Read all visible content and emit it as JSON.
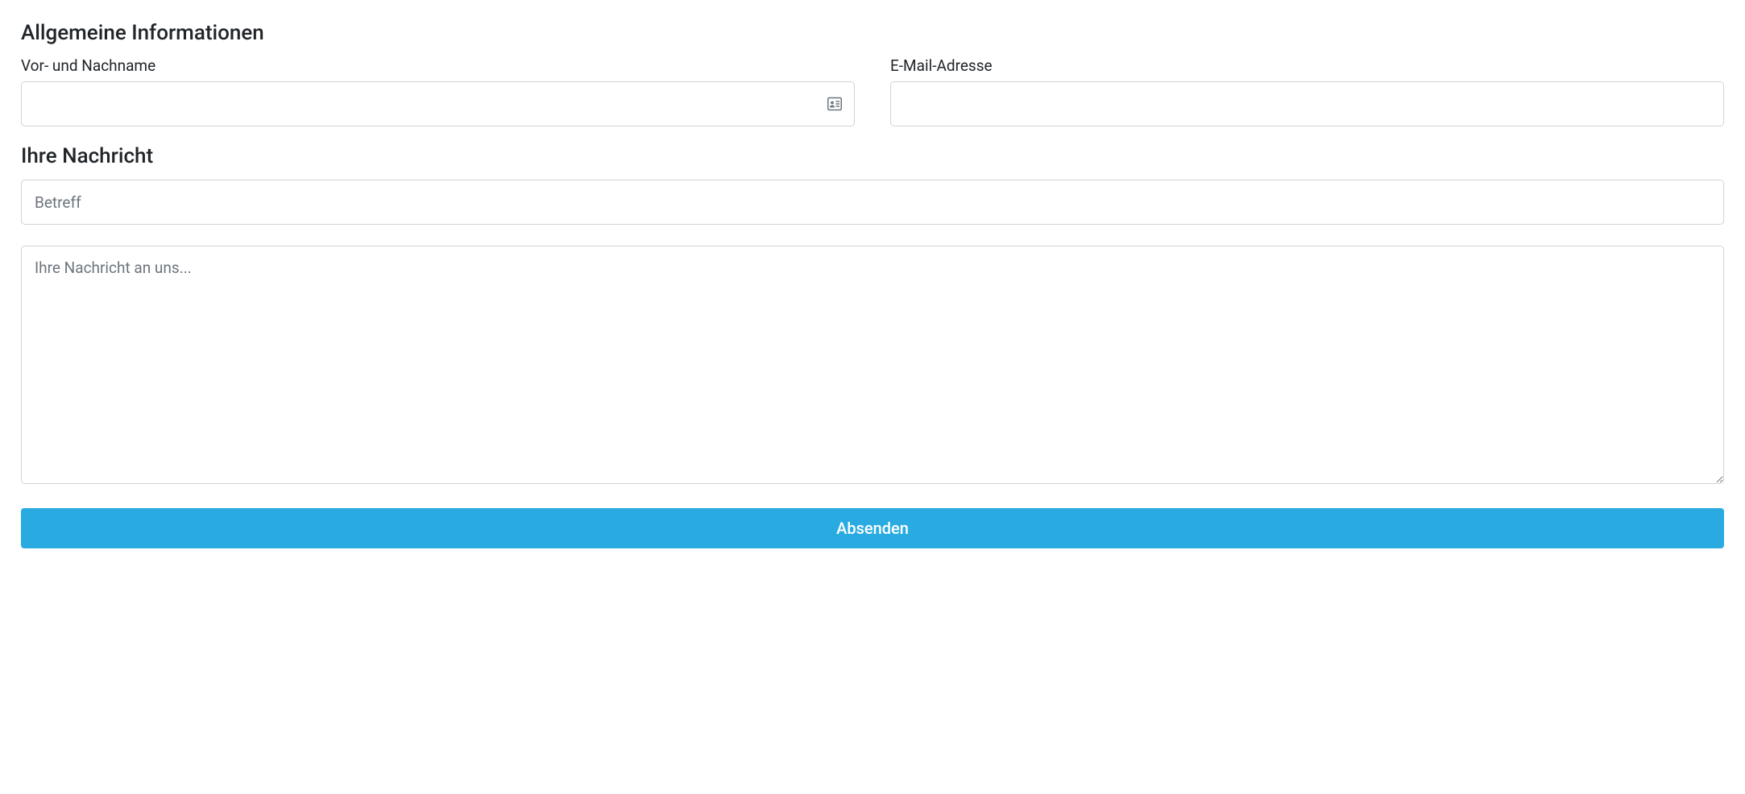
{
  "sections": {
    "general": {
      "heading": "Allgemeine Informationen",
      "name_label": "Vor- und Nachname",
      "email_label": "E-Mail-Adresse"
    },
    "message": {
      "heading": "Ihre Nachricht",
      "subject_placeholder": "Betreff",
      "message_placeholder": "Ihre Nachricht an uns..."
    }
  },
  "submit_label": "Absenden"
}
